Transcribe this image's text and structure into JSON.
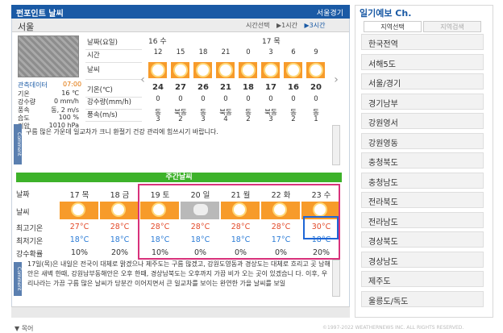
{
  "header": {
    "title": "펀포인트 날씨",
    "region": "서울경기"
  },
  "subheader": {
    "city": "서울",
    "time_select_label": "시간선택",
    "option_1h": "▶1시간",
    "option_3h": "▶3시간"
  },
  "observation": {
    "title": "관측데이터",
    "time": "07:00",
    "rows": [
      {
        "label": "기온",
        "value": "16 ℃"
      },
      {
        "label": "강수량",
        "value": "0 mm/h"
      },
      {
        "label": "풍속",
        "value": "동, 2 m/s"
      },
      {
        "label": "습도",
        "value": "100 %"
      },
      {
        "label": "기압",
        "value": "1010 hPa"
      }
    ]
  },
  "hourly": {
    "row_labels": [
      "날짜(요일)",
      "시간",
      "날씨",
      "기온(℃)",
      "강수량(mm/h)",
      "풍속(m/s)"
    ],
    "date_16": "16 수",
    "date_17": "17 목",
    "hours": [
      "12",
      "15",
      "18",
      "21",
      "0",
      "3",
      "6",
      "9"
    ],
    "temps": [
      "24",
      "27",
      "26",
      "21",
      "18",
      "17",
      "16",
      "20"
    ],
    "rain": [
      "0",
      "0",
      "0",
      "0",
      "0",
      "0",
      "0",
      "0"
    ],
    "wind_dir": [
      "동",
      "북동",
      "동",
      "북동",
      "동",
      "북동",
      "동",
      "동"
    ],
    "wind_speed": [
      "3",
      "2",
      "3",
      "4",
      "2",
      "3",
      "2",
      "1"
    ]
  },
  "comment1": {
    "tag": "Comment",
    "text": "구름 많은 가운데 일교차가 크니 환절기 건강 관리에 힘쓰시기 바랍니다."
  },
  "weekly": {
    "title": "주간날씨",
    "labels": [
      "날짜",
      "날씨",
      "최고기온",
      "최저기온",
      "강수확률"
    ],
    "days": [
      "17 목",
      "18 금",
      "19 토",
      "20 일",
      "21 월",
      "22 화",
      "23 수"
    ],
    "highs": [
      "27°C",
      "28°C",
      "28°C",
      "28°C",
      "28°C",
      "28°C",
      "30°C"
    ],
    "lows": [
      "18°C",
      "18°C",
      "18°C",
      "18°C",
      "18°C",
      "17°C",
      "18°C"
    ],
    "pop": [
      "10%",
      "20%",
      "10%",
      "0%",
      "0%",
      "0%",
      "20%"
    ],
    "cloudy_index": 3
  },
  "comment2": {
    "tag": "Comment",
    "text": "17일(목)은 내일은 전국이 대체로 맑겠으나 제주도는 구름 많겠고, 강원도영동과 경상도는 대체로 흐리고 곳 남해안은 새벽 한때, 강원남부동해안은 오후 한때, 경상남북도는 오후까지 가끔 비가 오는 곳이 있겠습니 다. 이후, 우리나라는 가끔 구름 많은 날씨가 당분간 이어지면서 큰 일교차를 보이는 완연한 가을 날씨를 보일"
  },
  "sidebar": {
    "title": "일기예보 Ch.",
    "tab_region": "지역선택",
    "tab_search": "지역검색",
    "items": [
      "한국전역",
      "서해5도",
      "서울/경기",
      "경기남부",
      "강원영서",
      "강원영동",
      "충청북도",
      "충청남도",
      "전라북도",
      "전라남도",
      "경상북도",
      "경상남도",
      "제주도",
      "울릉도/독도"
    ]
  },
  "footer": {
    "left_text": "▼ 목어",
    "copyright": "©1997-2022 WEATHERNEWS INC. ALL RIGHTS RESERVED."
  },
  "colors": {
    "brand": "#1a5aa5",
    "sun_cell": "#f79b2a",
    "week_bar": "#3db22a",
    "highlight_red": "#d8327b",
    "highlight_blue": "#1e66d6"
  }
}
